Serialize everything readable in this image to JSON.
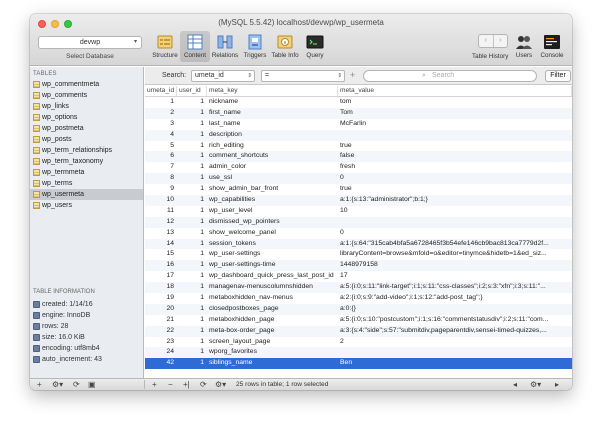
{
  "window": {
    "title": "(MySQL 5.5.42) localhost/devwp/wp_usermeta"
  },
  "toolbar": {
    "database": "devwp",
    "select_db_label": "Select Database",
    "tools": [
      "Structure",
      "Content",
      "Relations",
      "Triggers",
      "Table Info",
      "Query"
    ],
    "history_label": "Table History",
    "users_label": "Users",
    "console_label": "Console",
    "back_glyph": "‹",
    "forward_glyph": "›"
  },
  "sidebar": {
    "tables_header": "TABLES",
    "tables": [
      "wp_commentmeta",
      "wp_comments",
      "wp_links",
      "wp_options",
      "wp_postmeta",
      "wp_posts",
      "wp_term_relationships",
      "wp_term_taxonomy",
      "wp_termmeta",
      "wp_terms",
      "wp_usermeta",
      "wp_users"
    ],
    "selected_table": "wp_usermeta",
    "info_header": "TABLE INFORMATION",
    "info": [
      "created: 1/14/16",
      "engine: InnoDB",
      "rows: 28",
      "size: 16.0 KiB",
      "encoding: utf8mb4",
      "auto_increment: 43"
    ]
  },
  "filter": {
    "label": "Search:",
    "field": "umeta_id",
    "operator": "=",
    "placeholder": "Search",
    "button": "Filter",
    "plus": "+"
  },
  "grid": {
    "columns": [
      "umeta_id",
      "user_id",
      "meta_key",
      "meta_value"
    ],
    "rows": [
      [
        "1",
        "1",
        "nickname",
        "tom"
      ],
      [
        "2",
        "1",
        "first_name",
        "Tom"
      ],
      [
        "3",
        "1",
        "last_name",
        "McFarlin"
      ],
      [
        "4",
        "1",
        "description",
        ""
      ],
      [
        "5",
        "1",
        "rich_editing",
        "true"
      ],
      [
        "6",
        "1",
        "comment_shortcuts",
        "false"
      ],
      [
        "7",
        "1",
        "admin_color",
        "fresh"
      ],
      [
        "8",
        "1",
        "use_ssl",
        "0"
      ],
      [
        "9",
        "1",
        "show_admin_bar_front",
        "true"
      ],
      [
        "10",
        "1",
        "wp_capabilities",
        "a:1:{s:13:\"administrator\";b:1;}"
      ],
      [
        "11",
        "1",
        "wp_user_level",
        "10"
      ],
      [
        "12",
        "1",
        "dismissed_wp_pointers",
        ""
      ],
      [
        "13",
        "1",
        "show_welcome_panel",
        "0"
      ],
      [
        "14",
        "1",
        "session_tokens",
        "a:1:{s:64:\"315cab4bfa5a6728465f3b54efe146cb9bac813ca7779d2f..."
      ],
      [
        "15",
        "1",
        "wp_user-settings",
        "libraryContent=browse&mfold=o&editor=tinymce&hidetb=1&ed_siz..."
      ],
      [
        "16",
        "1",
        "wp_user-settings-time",
        "1448979158"
      ],
      [
        "17",
        "1",
        "wp_dashboard_quick_press_last_post_id",
        "17"
      ],
      [
        "18",
        "1",
        "managenav-menuscolumnshidden",
        "a:5:{i:0;s:11:\"link-target\";i:1;s:11:\"css-classes\";i:2;s:3:\"xfn\";i:3;s:11:\"..."
      ],
      [
        "19",
        "1",
        "metaboxhidden_nav-menus",
        "a:2:{i:0;s:9:\"add-video\";i:1;s:12:\"add-post_tag\";}"
      ],
      [
        "20",
        "1",
        "closedpostboxes_page",
        "a:0:{}"
      ],
      [
        "21",
        "1",
        "metaboxhidden_page",
        "a:5:{i:0;s:10:\"postcustom\";i:1;s:16:\"commentstatusdiv\";i:2;s:11:\"com..."
      ],
      [
        "22",
        "1",
        "meta-box-order_page",
        "a:3:{s:4:\"side\";s:57:\"submitdiv,pageparentdiv,sensei-timed-quizzes,..."
      ],
      [
        "23",
        "1",
        "screen_layout_page",
        "2"
      ],
      [
        "24",
        "1",
        "wporg_favorites",
        ""
      ],
      [
        "42",
        "1",
        "siblings_name",
        "Ben"
      ]
    ],
    "selected_row": 24
  },
  "bottombar": {
    "status": "25 rows in table; 1 row selected",
    "left_buttons": [
      "+",
      "⚙▾",
      "⟳",
      "▣"
    ],
    "mid_buttons": [
      "+",
      "−",
      "+|",
      "⟳",
      "⚙▾"
    ],
    "right_buttons": [
      "◂",
      "⚙▾",
      "▸"
    ]
  },
  "colors": {
    "selection": "#2f6bd6",
    "sidebar_bg": "#e9ecf0"
  }
}
